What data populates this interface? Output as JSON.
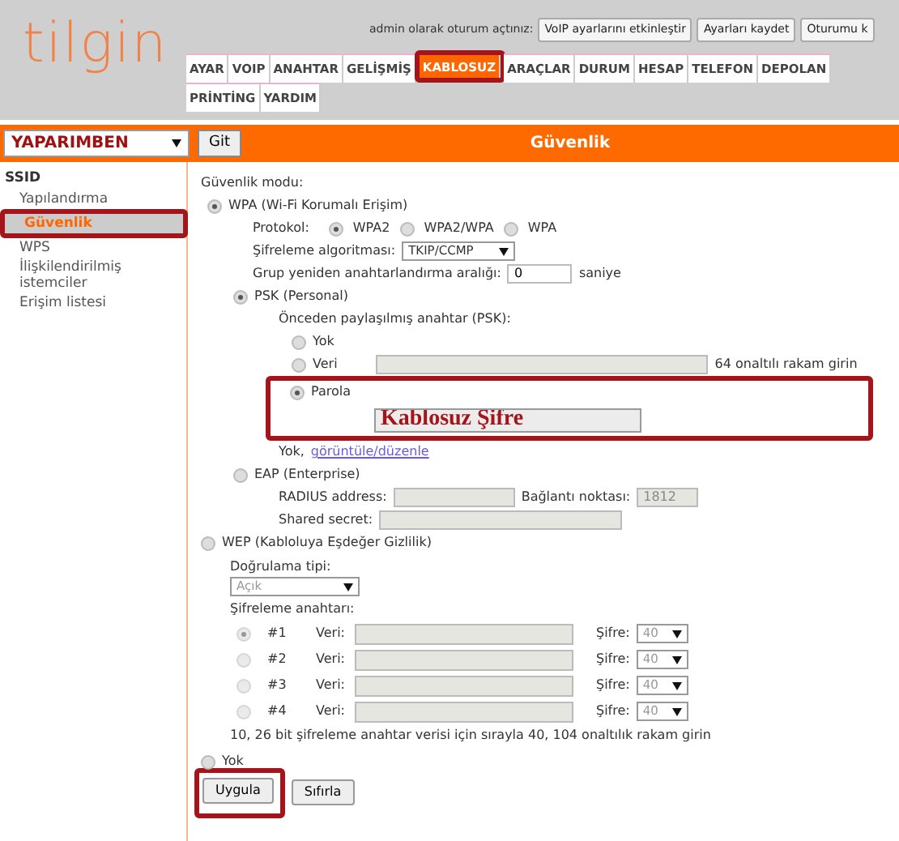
{
  "header": {
    "logo": "tilgin",
    "login_text": "admin olarak oturum açtınız:",
    "buttons": [
      {
        "label": "VoIP ayarlarını etkinleştir"
      },
      {
        "label": "Ayarları kaydet"
      },
      {
        "label": "Oturumu k"
      }
    ]
  },
  "nav_rows": [
    [
      {
        "label": "AYAR",
        "selected": false,
        "highlighted": false
      },
      {
        "label": "VOIP",
        "selected": false,
        "highlighted": false
      },
      {
        "label": "ANAHTAR",
        "selected": false,
        "highlighted": false
      },
      {
        "label": "GELİŞMİŞ",
        "selected": false,
        "highlighted": false
      },
      {
        "label": "KABLOSUZ",
        "selected": true,
        "highlighted": true
      },
      {
        "label": "ARAÇLAR",
        "selected": false,
        "highlighted": false
      },
      {
        "label": "DURUM",
        "selected": false,
        "highlighted": false
      },
      {
        "label": "HESAP",
        "selected": false,
        "highlighted": false
      },
      {
        "label": "TELEFON",
        "selected": false,
        "highlighted": false
      },
      {
        "label": "DEPOLAN",
        "selected": false,
        "highlighted": false
      }
    ],
    [
      {
        "label": "PRİNTİNG",
        "selected": false,
        "highlighted": false
      },
      {
        "label": "YARDIM",
        "selected": false,
        "highlighted": false
      }
    ]
  ],
  "toolbar": {
    "ssid_select": "YAPARIMBEN",
    "go_button": "Git",
    "title": "Güvenlik"
  },
  "sidebar": {
    "heading": "SSID",
    "items": [
      {
        "label": "Yapılandırma",
        "selected": false,
        "highlighted": false
      },
      {
        "label": "Güvenlik",
        "selected": true,
        "highlighted": true
      },
      {
        "label": "WPS",
        "selected": false,
        "highlighted": false
      },
      {
        "label": "İlişkilendirilmiş istemciler",
        "selected": false,
        "highlighted": false
      },
      {
        "label": "Erişim listesi",
        "selected": false,
        "highlighted": false
      }
    ]
  },
  "form": {
    "security_mode_label": "Güvenlik modu:",
    "wpa": {
      "label": "WPA (Wi-Fi Korumalı Erişim)",
      "selected": true,
      "protocol_label": "Protokol:",
      "protocols": [
        {
          "label": "WPA2",
          "selected": true
        },
        {
          "label": "WPA2/WPA",
          "selected": false
        },
        {
          "label": "WPA",
          "selected": false
        }
      ],
      "cipher_label": "Şifreleme algoritması:",
      "cipher_value": "TKIP/CCMP",
      "rekey_label": "Grup yeniden anahtarlandırma aralığı:",
      "rekey_value": "0",
      "rekey_unit": "saniye",
      "psk": {
        "label": "PSK (Personal)",
        "selected": true,
        "key_label": "Önceden paylaşılmış anahtar (PSK):",
        "options": [
          {
            "kind": "none",
            "label": "Yok",
            "selected": false
          },
          {
            "kind": "hex",
            "label": "Veri",
            "selected": false,
            "hint": "64 onaltılı rakam girin"
          },
          {
            "kind": "password",
            "label": "Parola",
            "selected": true,
            "value": "Kablosuz Şifre",
            "highlighted": true
          }
        ],
        "per_station_value": "Yok,",
        "per_station_link": "görüntüle/düzenle"
      },
      "eap": {
        "label": "EAP (Enterprise)",
        "selected": false,
        "radius_label": "RADIUS address:",
        "port_label": "Bağlantı noktası:",
        "port_value": "1812",
        "secret_label": "Shared secret:"
      }
    },
    "wep": {
      "label": "WEP (Kabloluya Eşdeğer Gizlilik)",
      "selected": false,
      "auth_label": "Doğrulama tipi:",
      "auth_value": "Açık",
      "keys_label": "Şifreleme anahtarı:",
      "keys": [
        {
          "index": "#1",
          "selected": true,
          "data_label": "Veri:",
          "cipher_label": "Şifre:",
          "cipher_value": "40"
        },
        {
          "index": "#2",
          "selected": false,
          "data_label": "Veri:",
          "cipher_label": "Şifre:",
          "cipher_value": "40"
        },
        {
          "index": "#3",
          "selected": false,
          "data_label": "Veri:",
          "cipher_label": "Şifre:",
          "cipher_value": "40"
        },
        {
          "index": "#4",
          "selected": false,
          "data_label": "Veri:",
          "cipher_label": "Şifre:",
          "cipher_value": "40"
        }
      ],
      "note": "10, 26 bit şifreleme anahtar verisi için sırayla 40, 104 onaltılık rakam girin"
    },
    "none_option": {
      "label": "Yok",
      "selected": false
    },
    "buttons": [
      {
        "label": "Uygula",
        "highlighted": true
      },
      {
        "label": "Sıfırla",
        "highlighted": false
      }
    ]
  }
}
